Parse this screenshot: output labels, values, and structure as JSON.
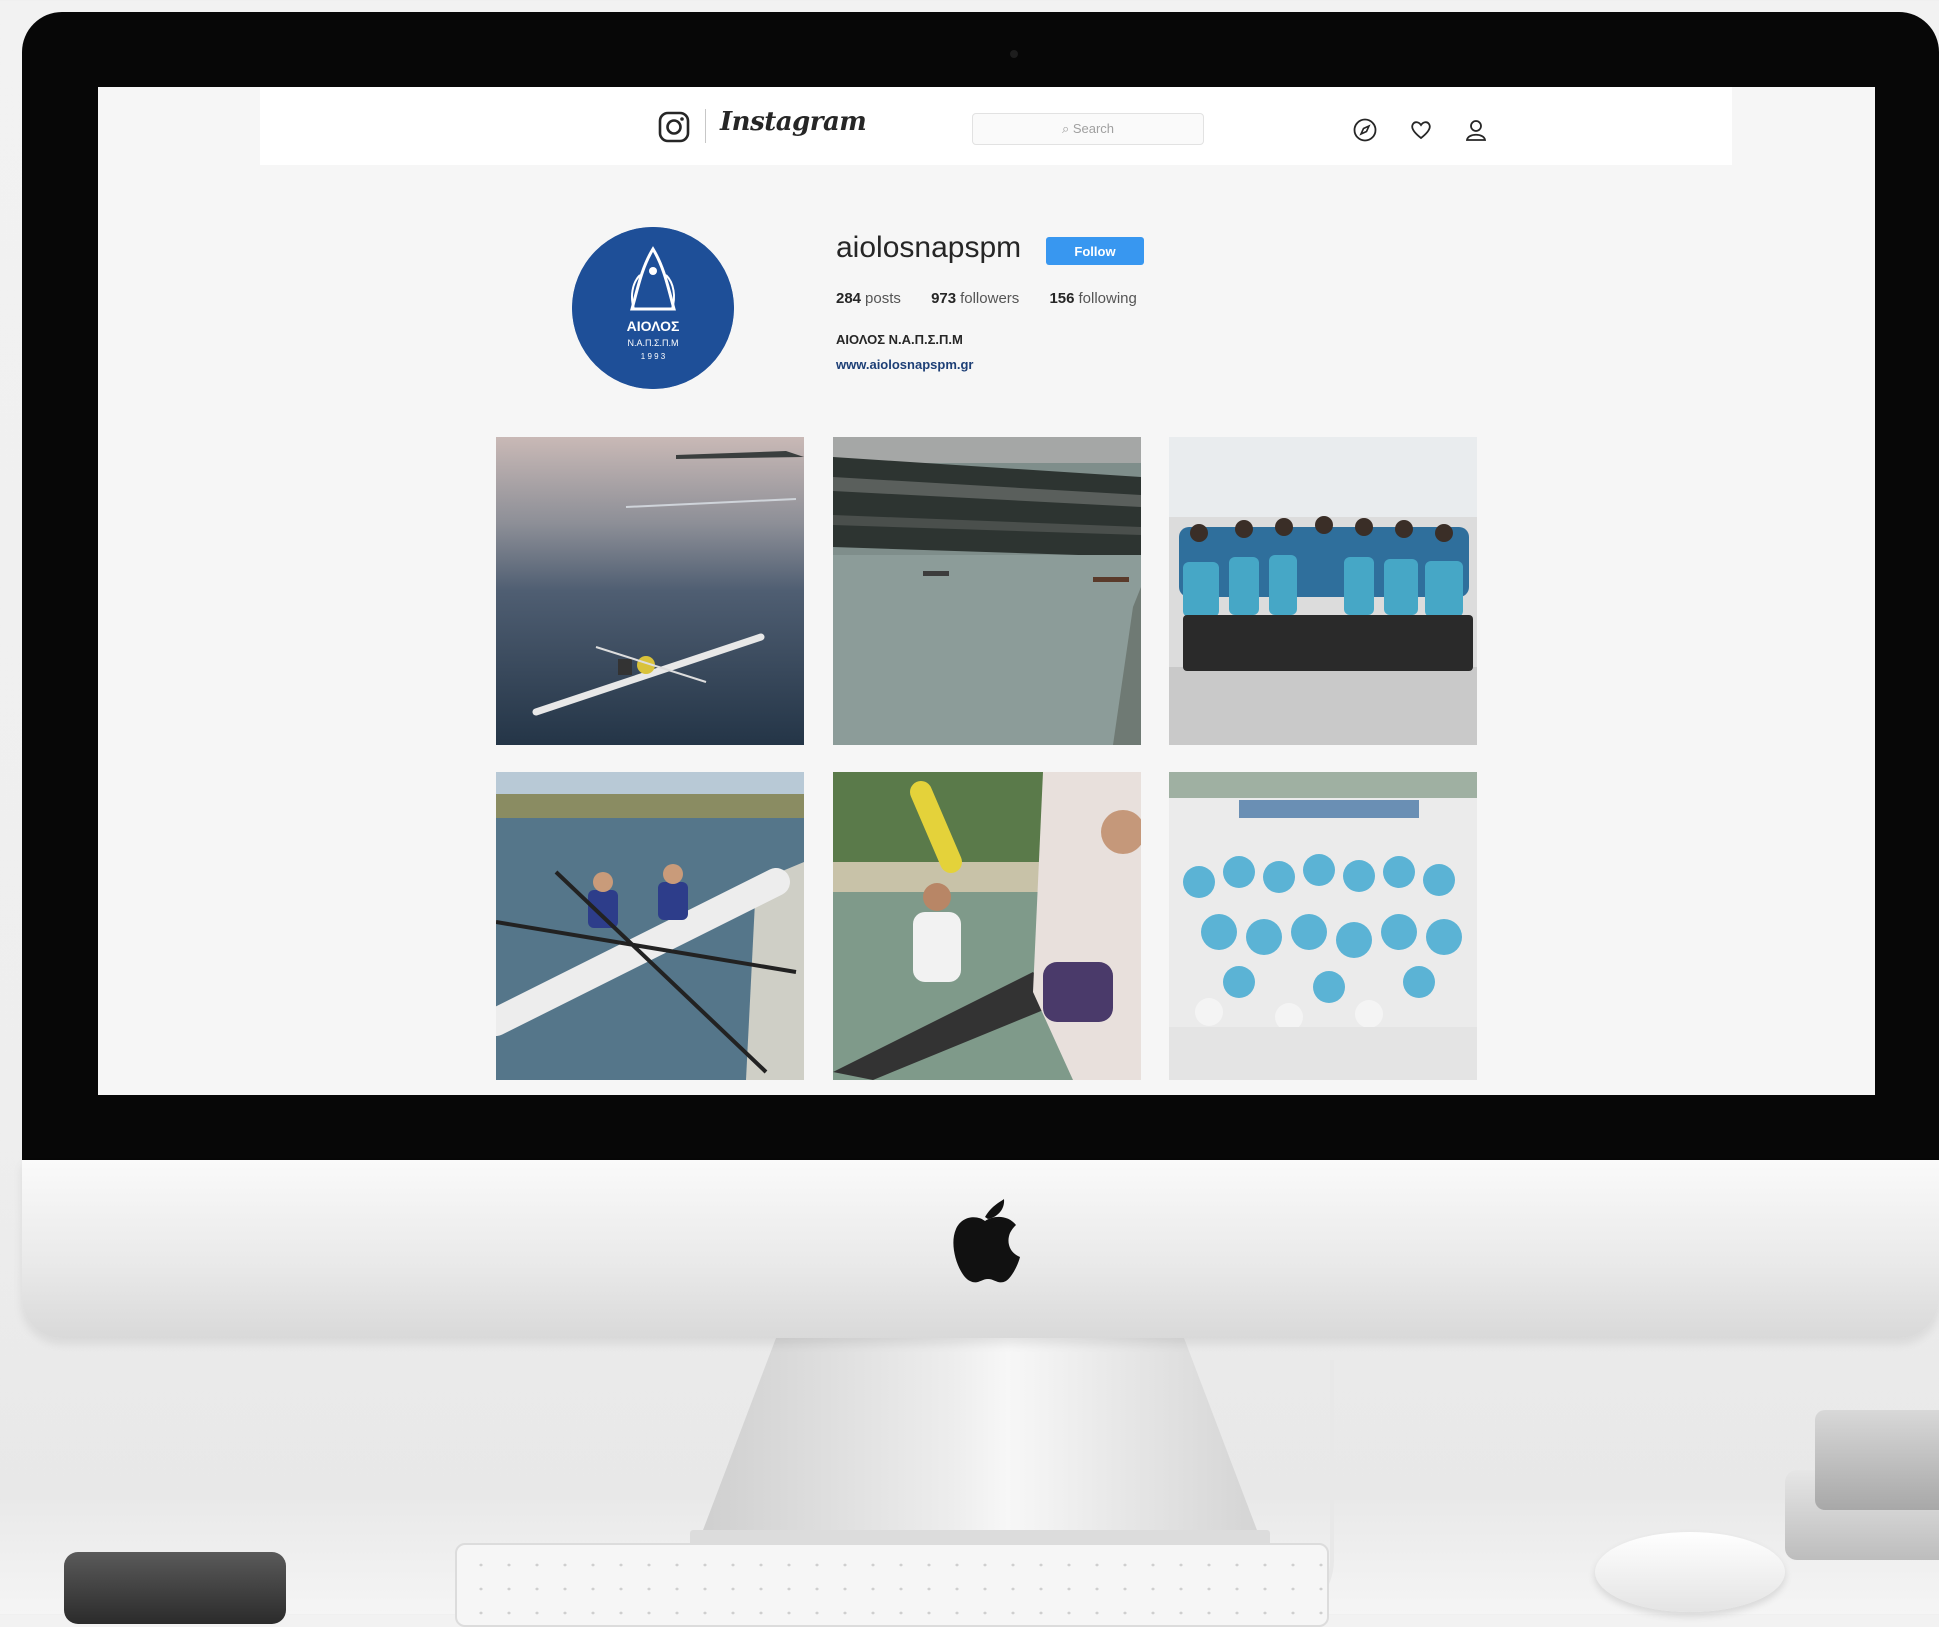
{
  "browser": {
    "brand_wordmark": "Instagram",
    "search_placeholder": "Search",
    "icons": [
      "instagram-camera-icon",
      "explore-compass-icon",
      "heart-icon",
      "user-icon"
    ]
  },
  "profile": {
    "username": "aiolosnapspm",
    "follow_label": "Follow",
    "posts_count": "284",
    "posts_label": "posts",
    "followers_count": "973",
    "followers_label": "followers",
    "following_count": "156",
    "following_label": "following",
    "full_name": "ΑΙΟΛΟΣ Ν.Α.Π.Σ.Π.Μ",
    "website": "www.aiolosnapspm.gr",
    "avatar": {
      "line1": "ΑΙΟΛΟΣ",
      "line2": "Ν.Α.Π.Σ.Π.Μ",
      "line3": "1 9 9 3",
      "color": "#1e4f98"
    }
  },
  "posts": [
    {
      "subject": "single sculler on calm lake at dusk"
    },
    {
      "subject": "rowing course with grandstand"
    },
    {
      "subject": "team group photo in blue shirts"
    },
    {
      "subject": "double scull rowers on river"
    },
    {
      "subject": "rowers in boat at dock"
    },
    {
      "subject": "large crowd photo with banner"
    }
  ],
  "colors": {
    "follow_button": "#3897f0",
    "link": "#1d3f76",
    "bezel": "#070707"
  }
}
